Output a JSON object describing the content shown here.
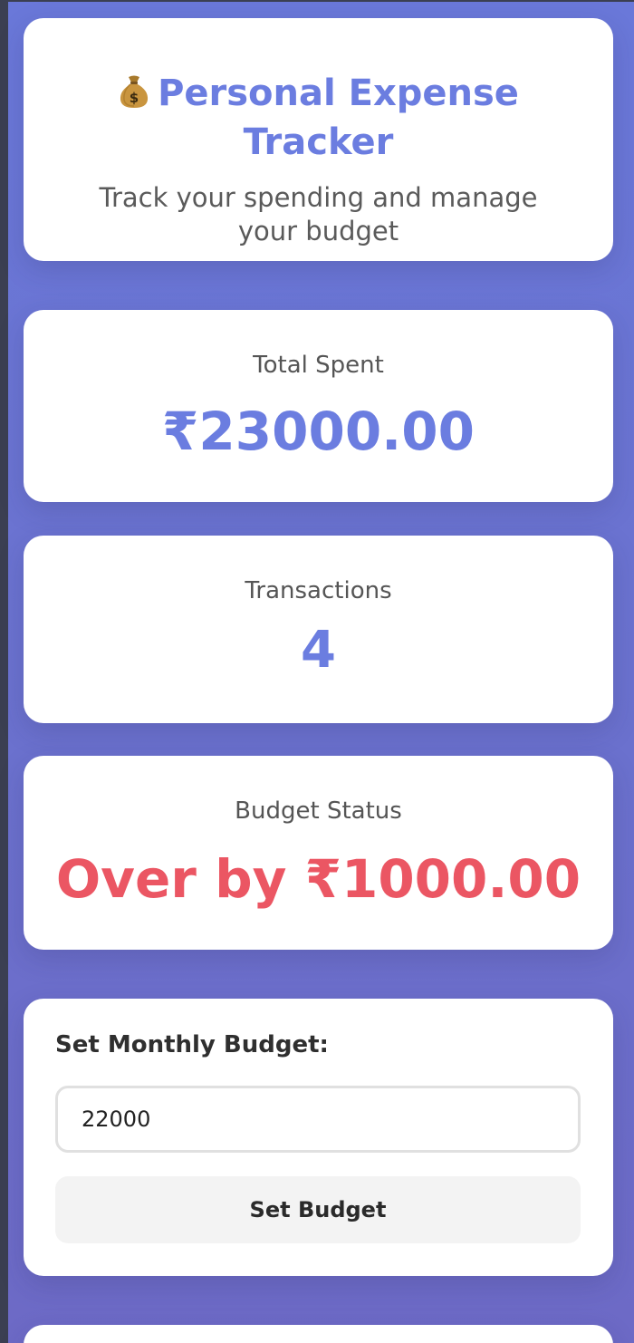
{
  "header": {
    "icon": "money-bag-icon",
    "title": "Personal Expense Tracker",
    "subtitle": "Track your spending and manage your budget"
  },
  "stats": {
    "total_spent": {
      "label": "Total Spent",
      "value": "₹23000.00"
    },
    "transactions": {
      "label": "Transactions",
      "value": "4"
    },
    "budget_status": {
      "label": "Budget Status",
      "value": "Over by ₹1000.00"
    }
  },
  "budget_form": {
    "label": "Set Monthly Budget:",
    "input_value": "22000",
    "button_label": "Set Budget"
  },
  "colors": {
    "accent": "#6b7de0",
    "over_budget": "#eb5663",
    "background_gradient_start": "#6a78d9",
    "background_gradient_end": "#6d6ac6"
  }
}
